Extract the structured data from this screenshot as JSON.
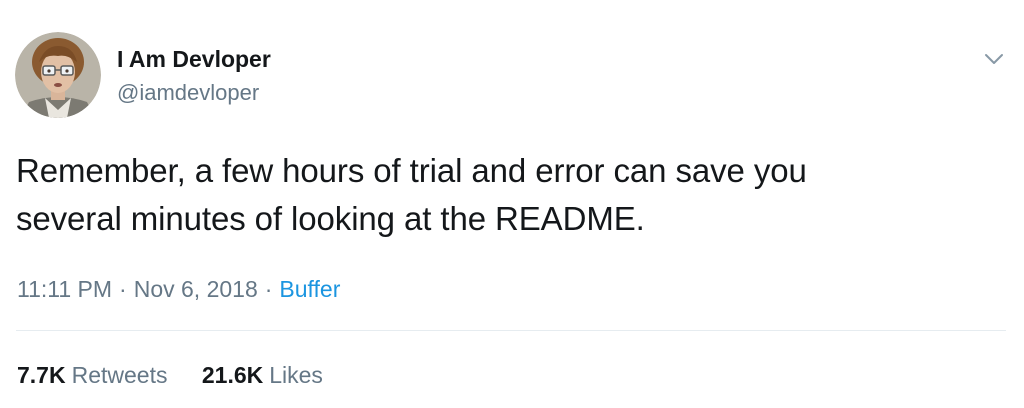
{
  "user": {
    "display_name": "I Am Devloper",
    "handle": "@iamdevloper",
    "avatar_icon": "profile-photo"
  },
  "tweet": {
    "text_line_1": "Remember, a few hours of trial and error can save you",
    "text_line_2": "several minutes of looking at the README.",
    "time": "11:11 PM",
    "separator": "·",
    "date": "Nov 6, 2018",
    "source": "Buffer"
  },
  "stats": {
    "retweets_count": "7.7K",
    "retweets_label": "Retweets",
    "likes_count": "21.6K",
    "likes_label": "Likes"
  },
  "colors": {
    "text_primary": "#14171a",
    "text_secondary": "#657786",
    "link": "#1b95e0",
    "divider": "#e6ecf0"
  },
  "icons": {
    "menu_caret": "chevron-down-icon"
  }
}
